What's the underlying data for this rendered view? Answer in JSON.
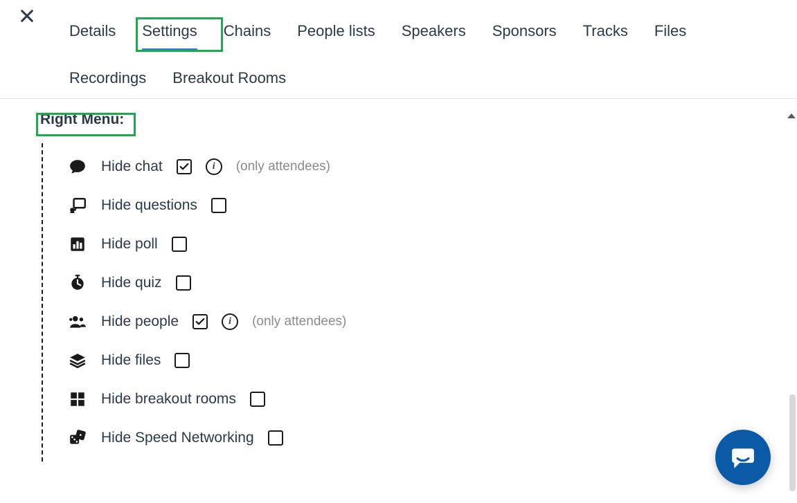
{
  "tabs": [
    {
      "label": "Details",
      "active": false
    },
    {
      "label": "Settings",
      "active": true
    },
    {
      "label": "Chains",
      "active": false
    },
    {
      "label": "People lists",
      "active": false
    },
    {
      "label": "Speakers",
      "active": false
    },
    {
      "label": "Sponsors",
      "active": false
    },
    {
      "label": "Tracks",
      "active": false
    },
    {
      "label": "Files",
      "active": false
    },
    {
      "label": "Recordings",
      "active": false
    },
    {
      "label": "Breakout Rooms",
      "active": false
    }
  ],
  "section": {
    "title": "Right Menu:"
  },
  "options": [
    {
      "icon": "chat",
      "label": "Hide chat",
      "checked": true,
      "info": true,
      "hint": "(only attendees)"
    },
    {
      "icon": "questions",
      "label": "Hide questions",
      "checked": false,
      "info": false,
      "hint": ""
    },
    {
      "icon": "poll",
      "label": "Hide poll",
      "checked": false,
      "info": false,
      "hint": ""
    },
    {
      "icon": "quiz",
      "label": "Hide quiz",
      "checked": false,
      "info": false,
      "hint": ""
    },
    {
      "icon": "people",
      "label": "Hide people",
      "checked": true,
      "info": true,
      "hint": "(only attendees)"
    },
    {
      "icon": "files",
      "label": "Hide files",
      "checked": false,
      "info": false,
      "hint": ""
    },
    {
      "icon": "breakout",
      "label": "Hide breakout rooms",
      "checked": false,
      "info": false,
      "hint": ""
    },
    {
      "icon": "dice",
      "label": "Hide Speed Networking",
      "checked": false,
      "info": false,
      "hint": ""
    }
  ],
  "info_glyph": "i"
}
